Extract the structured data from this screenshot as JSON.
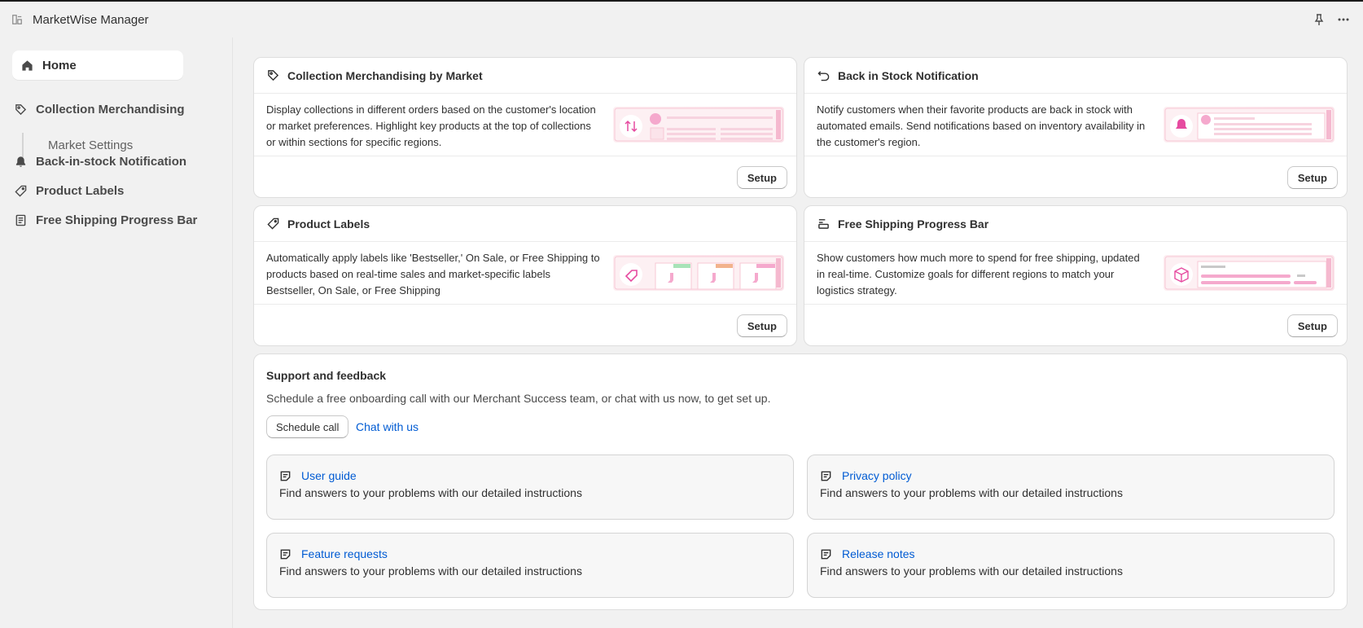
{
  "app": {
    "title": "MarketWise Manager"
  },
  "sidebar": {
    "home": "Home",
    "items": [
      {
        "label": "Collection Merchandising",
        "icon": "tag-icon"
      },
      {
        "label": "Back-in-stock Notification",
        "icon": "bell-icon"
      },
      {
        "label": "Product Labels",
        "icon": "label-icon"
      },
      {
        "label": "Free Shipping Progress Bar",
        "icon": "receipt-icon"
      }
    ],
    "sub_item": "Market Settings"
  },
  "features": [
    {
      "title": "Collection Merchandising by Market",
      "icon": "tag-icon",
      "description": "Display collections in different orders based on the customer's location or market preferences. Highlight key products at the top of collections or within sections for specific regions.",
      "button": "Setup"
    },
    {
      "title": "Back in Stock Notification",
      "icon": "undo-icon",
      "description": "Notify customers when their favorite products are back in stock with automated emails. Send notifications based on inventory availability in the customer's region.",
      "button": "Setup"
    },
    {
      "title": "Product Labels",
      "icon": "label-icon",
      "description": "Automatically apply labels like 'Bestseller,' On Sale, or Free Shipping to products based on real-time sales and market-specific labels Bestseller, On Sale, or Free Shipping",
      "button": "Setup"
    },
    {
      "title": "Free Shipping Progress Bar",
      "icon": "text-align-icon",
      "description": "Show customers how much more to spend for free shipping, updated in real-time. Customize goals for different regions to match your logistics strategy.",
      "button": "Setup"
    }
  ],
  "support": {
    "title": "Support and feedback",
    "description": "Schedule a free onboarding call with our Merchant Success team, or chat with us now, to get set up.",
    "schedule_button": "Schedule call",
    "chat_link": "Chat with us",
    "resources": [
      {
        "title": "User guide",
        "description": "Find answers to your problems with our detailed instructions"
      },
      {
        "title": "Privacy policy",
        "description": "Find answers to your problems with our detailed instructions"
      },
      {
        "title": "Feature requests",
        "description": "Find answers to your problems with our detailed instructions"
      },
      {
        "title": "Release notes",
        "description": "Find answers to your problems with our detailed instructions"
      }
    ]
  },
  "colors": {
    "accent_link": "#005bd3",
    "preview_pink": "#e64ba0",
    "background": "#f1f1f1"
  }
}
